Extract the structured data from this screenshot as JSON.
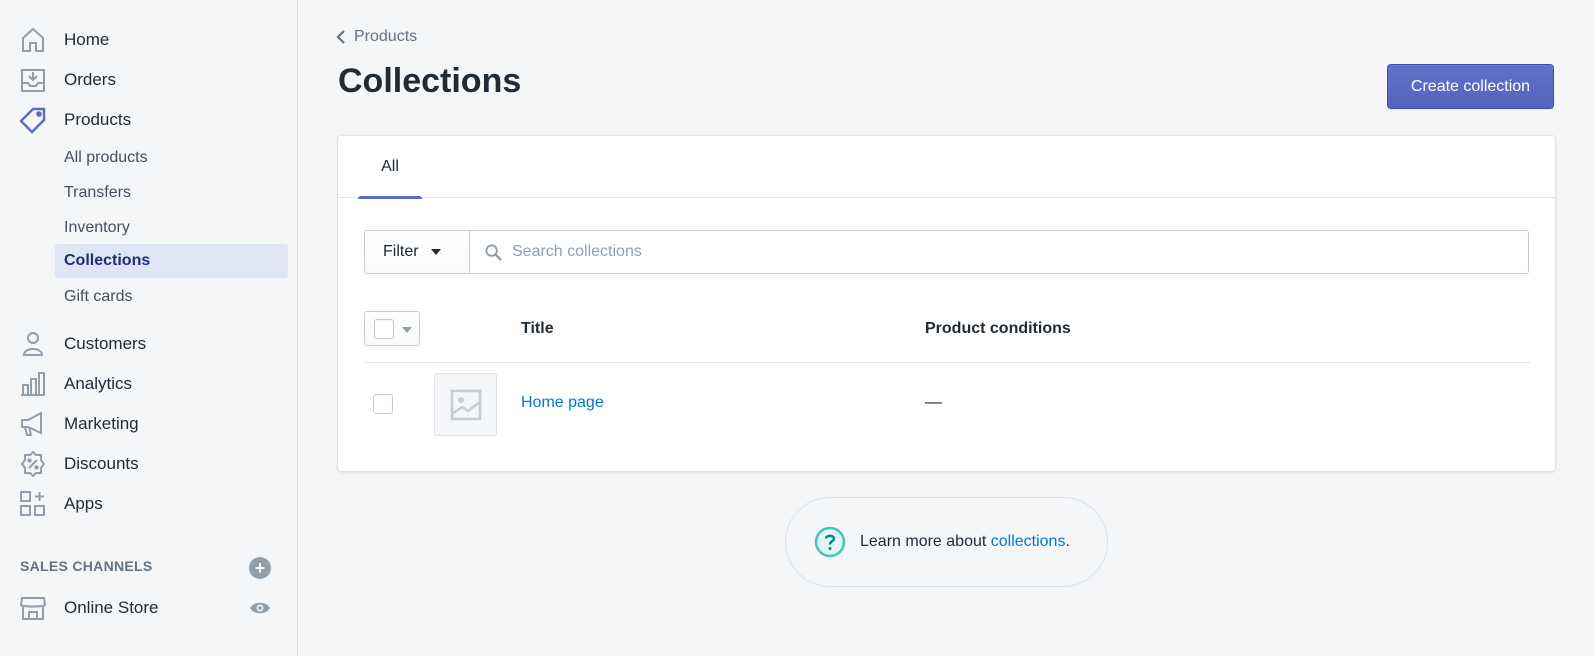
{
  "sidebar": {
    "items": [
      {
        "label": "Home",
        "icon": "home-icon"
      },
      {
        "label": "Orders",
        "icon": "orders-icon"
      },
      {
        "label": "Products",
        "icon": "tag-icon"
      },
      {
        "label": "Customers",
        "icon": "person-icon"
      },
      {
        "label": "Analytics",
        "icon": "bar-chart-icon"
      },
      {
        "label": "Marketing",
        "icon": "megaphone-icon"
      },
      {
        "label": "Discounts",
        "icon": "discount-badge-icon"
      },
      {
        "label": "Apps",
        "icon": "apps-grid-icon"
      }
    ],
    "product_sub_items": [
      {
        "label": "All products"
      },
      {
        "label": "Transfers"
      },
      {
        "label": "Inventory"
      },
      {
        "label": "Collections",
        "selected": true
      },
      {
        "label": "Gift cards"
      }
    ],
    "sales_channels_heading": "SALES CHANNELS",
    "online_store": "Online Store",
    "accent_color": "#5c6ac4"
  },
  "header": {
    "breadcrumb": "Products",
    "title": "Collections",
    "primary_action": "Create collection"
  },
  "card": {
    "tabs": [
      {
        "label": "All",
        "selected": true
      }
    ],
    "filter_label": "Filter",
    "search_placeholder": "Search collections",
    "columns": {
      "title": "Title",
      "conditions": "Product conditions"
    },
    "rows": [
      {
        "title": "Home page",
        "conditions": "—"
      }
    ]
  },
  "help": {
    "prefix": "Learn more about ",
    "link": "collections",
    "suffix": "."
  }
}
